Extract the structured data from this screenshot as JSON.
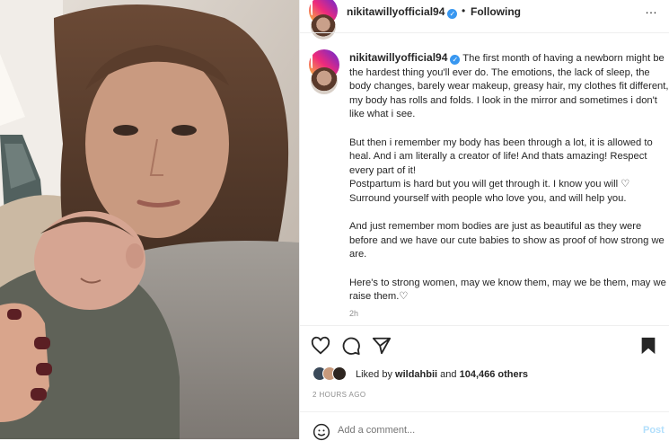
{
  "post": {
    "username": "nikitawillyofficial94",
    "verified_mark": "✓",
    "separator": "•",
    "follow_state": "Following",
    "more_icon": "…",
    "caption_paragraphs": [
      "The first month of having a newborn might be the hardest thing you'll ever do. The emotions, the lack of sleep, the body changes, barely wear makeup, greasy hair, my clothes fit different, my body has rolls and folds. I look in the mirror and sometimes i don't like what i see.",
      "But then i remember my body has been through a lot, it is allowed to heal. And i am literally a creator of life! And thats amazing! Respect every part of it!",
      "Postpartum is hard but you will get through it. I know you will ♡ Surround yourself with people who love you, and will help you.",
      "And just remember mom bodies are just as beautiful as they were before and we have our cute babies to show as proof of how strong we are.",
      "Here's to strong women, may we know them, may we be them, may we raise them.♡"
    ],
    "relative_time": "2h",
    "likes_prefix": "Liked by",
    "liked_by_user": "wildahbii",
    "likes_and": "and",
    "likes_count": "104,466 others",
    "date": "2 HOURS AGO",
    "comment_placeholder": "Add a comment...",
    "post_button": "Post"
  },
  "icons": {
    "like": "heart-icon",
    "comment": "comment-icon",
    "share": "share-icon",
    "save": "bookmark-icon",
    "emoji": "emoji-icon"
  },
  "colors": {
    "verified": "#3897f0",
    "post_button_disabled": "#b2dffc",
    "muted_text": "#8e8e8e"
  }
}
